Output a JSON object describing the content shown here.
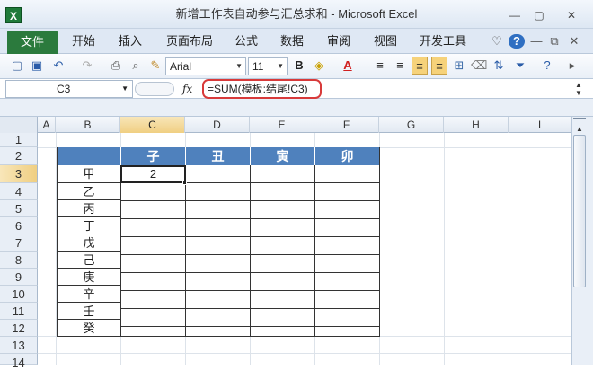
{
  "window": {
    "title": "新增工作表自动参与汇总求和 - Microsoft Excel",
    "app_icon": "X",
    "controls": [
      "—",
      "▢",
      "✕"
    ]
  },
  "ribbon": {
    "file_tab": "文件",
    "tabs": [
      "开始",
      "插入",
      "页面布局",
      "公式",
      "数据",
      "审阅",
      "视图",
      "开发工具"
    ],
    "right_icons": [
      "♡",
      "?",
      "—",
      "⧉",
      "✕"
    ]
  },
  "toolbar": {
    "font_name": "Arial",
    "font_size": "11",
    "bold": "B",
    "font_color": "A"
  },
  "formula_bar": {
    "name_box": "C3",
    "fx": "fx",
    "formula": "=SUM(模板:结尾!C3)"
  },
  "sheet": {
    "columns": [
      "A",
      "B",
      "C",
      "D",
      "E",
      "F",
      "G",
      "H",
      "I"
    ],
    "rows": [
      "1",
      "2",
      "3",
      "4",
      "5",
      "6",
      "7",
      "8",
      "9",
      "10",
      "11",
      "12",
      "13",
      "14"
    ],
    "table_headers": [
      "子",
      "丑",
      "寅",
      "卯"
    ],
    "row_labels": [
      "甲",
      "乙",
      "丙",
      "丁",
      "戊",
      "己",
      "庚",
      "辛",
      "壬",
      "癸"
    ],
    "active_cell_value": "2"
  }
}
